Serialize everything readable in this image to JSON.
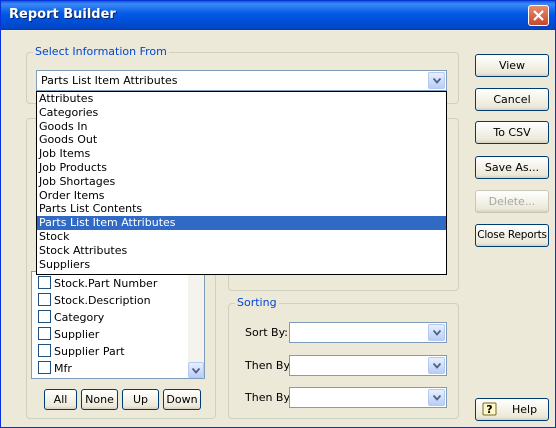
{
  "window": {
    "title": "Report Builder"
  },
  "select_info": {
    "legend": "Select Information From",
    "selected": "Parts List Item Attributes",
    "options": [
      "Attributes",
      "Categories",
      "Goods In",
      "Goods Out",
      "Job Items",
      "Job Products",
      "Job Shortages",
      "Order Items",
      "Parts List Contents",
      "Parts List Item Attributes",
      "Stock",
      "Stock Attributes",
      "Suppliers"
    ],
    "selected_index": 9
  },
  "fields": {
    "items": [
      "Stock.Part Number",
      "Stock.Description",
      "Category",
      "Supplier",
      "Supplier Part",
      "Mfr"
    ],
    "buttons": {
      "all": "All",
      "none": "None",
      "up": "Up",
      "down": "Down"
    }
  },
  "sorting": {
    "legend": "Sorting",
    "sort_by_label": "Sort By:",
    "then_by_label_1": "Then By:",
    "then_by_label_2": "Then By:",
    "sort_by_value": "",
    "then_by_value_1": "",
    "then_by_value_2": ""
  },
  "buttons": {
    "view": "View",
    "cancel": "Cancel",
    "to_csv": "To CSV",
    "save_as": "Save As...",
    "delete": "Delete...",
    "close_reports": "Close Reports",
    "help": "Help"
  },
  "colors": {
    "accent": "#316ac5",
    "legend": "#0046d5",
    "title_bar": "#0058e6"
  },
  "icons": {
    "help": "help-question-icon",
    "close": "close-icon"
  }
}
